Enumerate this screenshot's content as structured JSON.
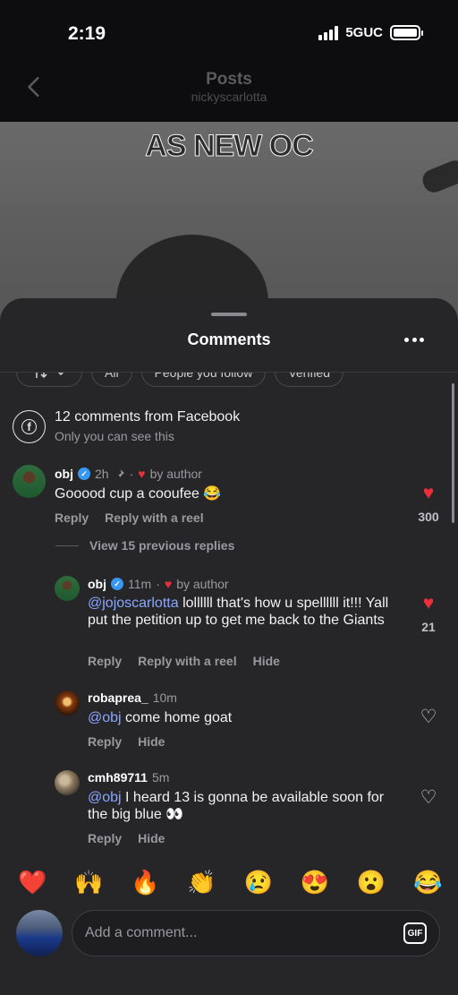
{
  "status_bar": {
    "time": "2:19",
    "network": "5GUC"
  },
  "header": {
    "title": "Posts",
    "subtitle": "nickyscarlotta"
  },
  "post": {
    "caption": "AS NEW OC"
  },
  "sheet": {
    "title": "Comments",
    "filters": [
      {
        "label": ""
      },
      {
        "label": "All"
      },
      {
        "label": "People you follow"
      },
      {
        "label": "Verified"
      }
    ]
  },
  "facebook_notice": {
    "title": "12 comments from Facebook",
    "subtitle": "Only you can see this"
  },
  "comments": [
    {
      "username": "obj",
      "verified": true,
      "time": "2h",
      "liked_by_author": "by author",
      "text": "Gooood cup a cooufee 😂",
      "actions": [
        "Reply",
        "Reply with a reel"
      ],
      "likes": "300",
      "liked": true
    }
  ],
  "view_previous": "View 15 previous replies",
  "replies": [
    {
      "username": "obj",
      "verified": true,
      "time": "11m",
      "liked_by_author": "by author",
      "mention": "@jojoscarlotta",
      "text": " lollllll that's how u spellllll it!!! Yall put the petition up to get me back to the Giants",
      "actions": [
        "Reply",
        "Reply with a reel",
        "Hide"
      ],
      "likes": "21",
      "liked": true
    },
    {
      "username": "robaprea_",
      "time": "10m",
      "mention": "@obj",
      "text": " come home goat",
      "actions": [
        "Reply",
        "Hide"
      ],
      "liked": false
    },
    {
      "username": "cmh89711",
      "time": "5m",
      "mention": "@obj",
      "text": " I heard 13 is gonna be available soon for the big blue 👀",
      "actions": [
        "Reply",
        "Hide"
      ],
      "liked": false
    }
  ],
  "emoji_reactions": [
    "❤️",
    "🙌",
    "🔥",
    "👏",
    "😢",
    "😍",
    "😮",
    "😂"
  ],
  "composer": {
    "placeholder": "Add a comment...",
    "gif_label": "GIF"
  },
  "colors": {
    "sheet_bg": "#262629",
    "like_red": "#ed2f3c",
    "mention_blue": "#8aa7ff",
    "verified_blue": "#3897f0"
  },
  "icons": [
    "back-chevron-icon",
    "more-icon",
    "facebook-icon",
    "verified-icon",
    "pin-icon",
    "heart-icon",
    "gif-icon"
  ]
}
